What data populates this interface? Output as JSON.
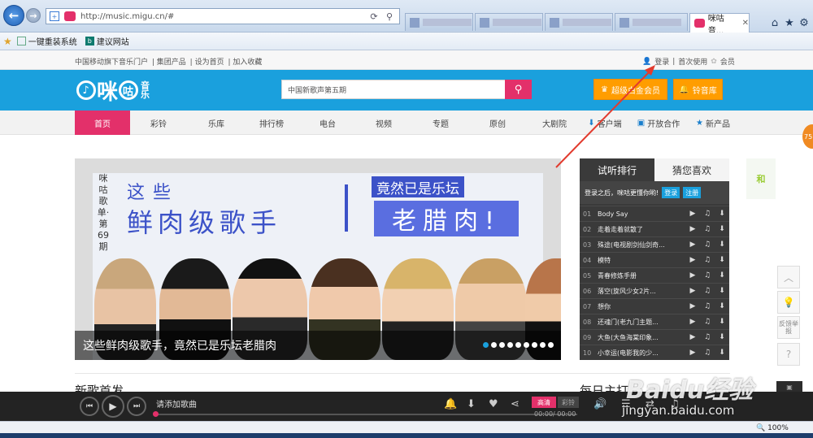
{
  "browser": {
    "url": "http://music.migu.cn/#",
    "active_tab_title": "咪咕音...",
    "favorites": [
      "一键重装系统",
      "建议网站"
    ],
    "zoom": "100%"
  },
  "site": {
    "top_links": [
      "中国移动旗下音乐门户",
      "集团产品",
      "设为首页",
      "加入收藏"
    ],
    "account": [
      "登录",
      "首次使用",
      "会员"
    ],
    "logo": "咪咕音乐",
    "search_placeholder": "中国新歌声第五期",
    "vip_button": "超级白金会员",
    "ring_button": "铃音库",
    "nav": [
      "首页",
      "彩铃",
      "乐库",
      "排行榜",
      "电台",
      "视频",
      "专题",
      "原创",
      "大剧院",
      "客户端",
      "开放合作",
      "新产品"
    ]
  },
  "banner": {
    "vertical_text": "咪咕歌单·第69期",
    "line1": "这些",
    "line2": "鲜肉级歌手",
    "badge1": "竟然已是乐坛",
    "badge2": "老腊肉!",
    "caption": "这些鲜肉级歌手，竟然已是乐坛老腊肉"
  },
  "panel": {
    "tab1": "试听排行",
    "tab2": "猜您喜欢",
    "login_hint": "登录之后，咪咕更懂你哟!",
    "login_btn": "登录",
    "register_btn": "注册",
    "songs": [
      {
        "no": "01",
        "title": "Body Say"
      },
      {
        "no": "02",
        "title": "走着走着就散了"
      },
      {
        "no": "03",
        "title": "殊途(电视剧剑仙剑奇..."
      },
      {
        "no": "04",
        "title": "模特"
      },
      {
        "no": "05",
        "title": "青春修炼手册"
      },
      {
        "no": "06",
        "title": "落空(旋风少女2片..."
      },
      {
        "no": "07",
        "title": "想你"
      },
      {
        "no": "08",
        "title": "还魂门(老九门主题..."
      },
      {
        "no": "09",
        "title": "大鱼(大鱼海棠印象..."
      },
      {
        "no": "10",
        "title": "小幸运(电影我的少..."
      }
    ]
  },
  "sections": {
    "left": "新歌首发",
    "right": "每日主打"
  },
  "side": {
    "ad_text": "和",
    "report": "反馈举报",
    "badge": "75"
  },
  "player": {
    "placeholder": "请添加歌曲",
    "quality_high": "高清",
    "quality_ring": "彩铃",
    "time": "00:00/ 00:00"
  },
  "watermark": {
    "line1": "Baidu经验",
    "line2": "jingyan.baidu.com"
  },
  "colors": {
    "brand_blue": "#1aa0dd",
    "brand_pink": "#e3306a",
    "vip_orange": "#ff9d00",
    "panel_dark": "#3a3a3a"
  }
}
